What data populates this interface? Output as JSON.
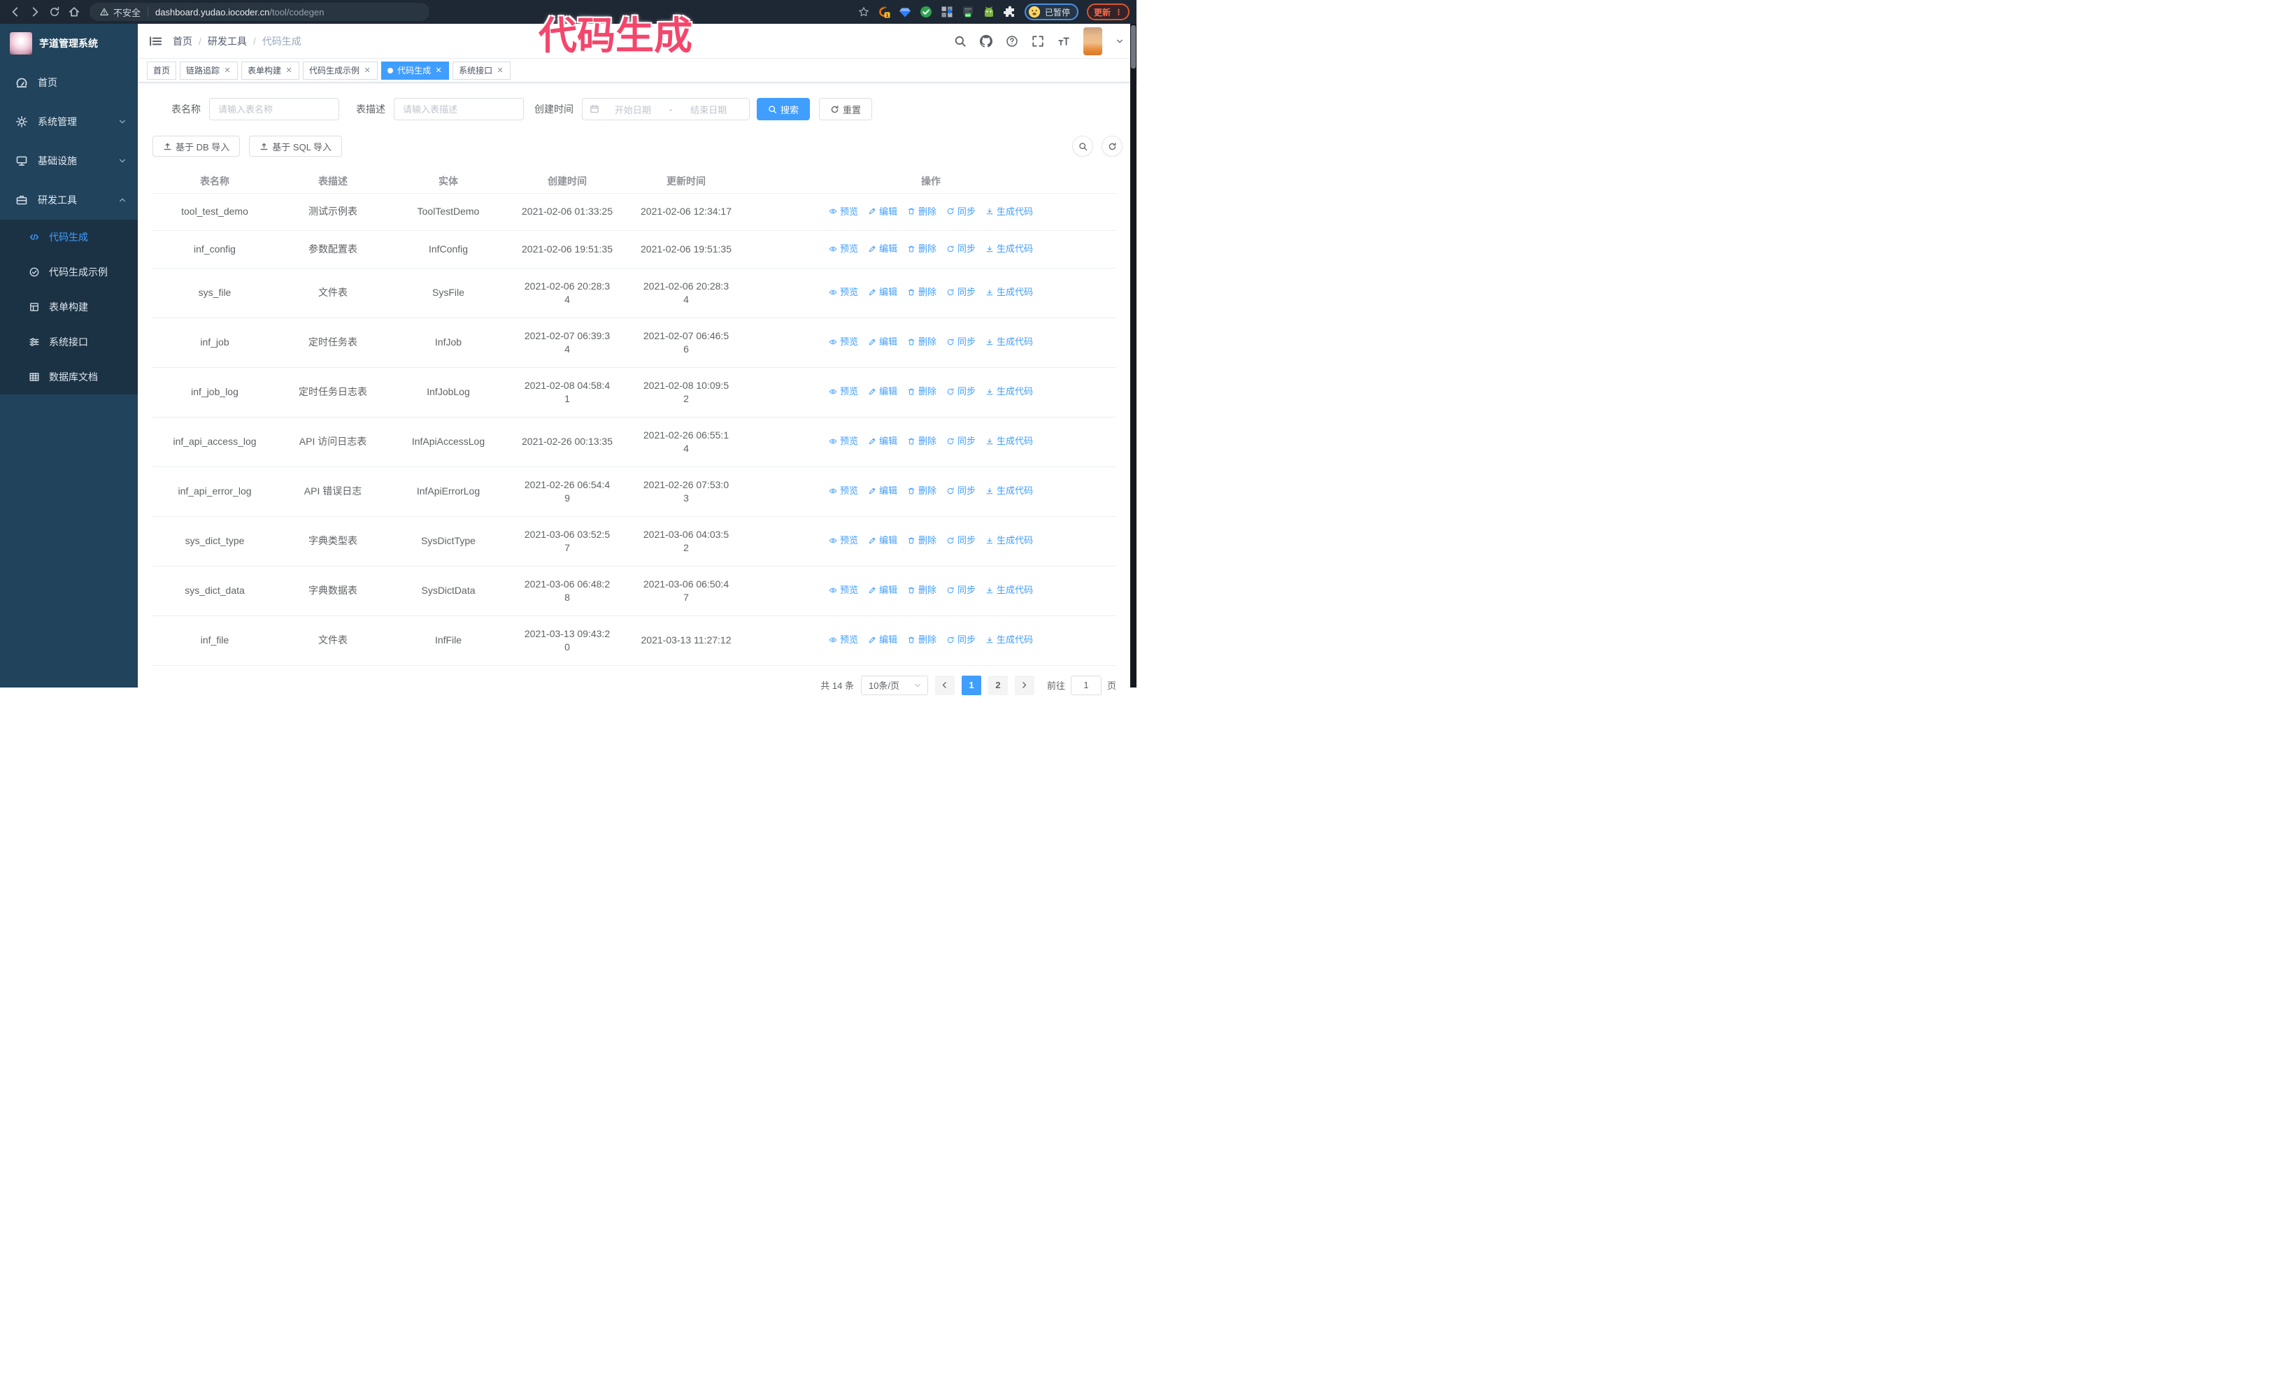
{
  "browser": {
    "nav_icons": [
      "back-icon",
      "forward-icon",
      "reload-icon",
      "home-icon"
    ],
    "security_icon": "warning-icon",
    "security_label": "不安全",
    "url_host": "dashboard.yudao.iocoder.cn",
    "url_path": "/tool/codegen",
    "bookmark_icon": "star-icon",
    "extension_icons": [
      "ext-adblock-icon",
      "ext-gem-icon",
      "ext-check-icon",
      "ext-grid-icon",
      "ext-dark-on-icon",
      "ext-droid-icon",
      "ext-puzzle-icon"
    ],
    "profile_badge": "已暂停",
    "profile_emoji_icon": "emoji-face-icon",
    "update_button": "更新",
    "update_menu_dots": "⋮"
  },
  "annotation": {
    "text": "代码生成",
    "color": "#f4466b"
  },
  "sidebar": {
    "logo_title": "芋道管理系统",
    "menu": [
      {
        "icon": "dashboard-icon",
        "label": "首页"
      },
      {
        "icon": "gear-icon",
        "label": "系统管理",
        "chevron_icon": "chevron-down-icon"
      },
      {
        "icon": "infrastructure-icon",
        "label": "基础设施",
        "chevron_icon": "chevron-down-icon"
      },
      {
        "icon": "tools-icon",
        "label": "研发工具",
        "chevron_icon": "chevron-up-icon",
        "expanded": true
      }
    ],
    "submenu": [
      {
        "icon": "code-icon",
        "label": "代码生成",
        "active": true
      },
      {
        "icon": "example-icon",
        "label": "代码生成示例"
      },
      {
        "icon": "form-icon",
        "label": "表单构建"
      },
      {
        "icon": "api-icon",
        "label": "系统接口"
      },
      {
        "icon": "database-doc-icon",
        "label": "数据库文档"
      }
    ]
  },
  "header": {
    "breadcrumb": [
      {
        "label": "首页"
      },
      {
        "label": "研发工具"
      },
      {
        "label": "代码生成",
        "last": true
      }
    ],
    "action_icons": [
      "search-icon",
      "github-icon",
      "question-icon",
      "fullscreen-icon",
      "fontsize-icon"
    ]
  },
  "tabs": [
    {
      "label": "首页"
    },
    {
      "label": "链路追踪",
      "closable": true
    },
    {
      "label": "表单构建",
      "closable": true
    },
    {
      "label": "代码生成示例",
      "closable": true
    },
    {
      "label": "代码生成",
      "closable": true,
      "active": true
    },
    {
      "label": "系统接口",
      "closable": true
    }
  ],
  "search_form": {
    "table_name_label": "表名称",
    "table_name_placeholder": "请输入表名称",
    "table_desc_label": "表描述",
    "table_desc_placeholder": "请输入表描述",
    "create_time_label": "创建时间",
    "start_date_placeholder": "开始日期",
    "range_separator": "-",
    "end_date_placeholder": "结束日期",
    "search_button": "搜索",
    "reset_button": "重置"
  },
  "toolbar": {
    "import_db_button": "基于 DB 导入",
    "import_sql_button": "基于 SQL 导入",
    "right_buttons": [
      "search-icon",
      "refresh-icon"
    ]
  },
  "table": {
    "columns": [
      {
        "label": "表名称"
      },
      {
        "label": "表描述"
      },
      {
        "label": "实体"
      },
      {
        "label": "创建时间"
      },
      {
        "label": "更新时间"
      },
      {
        "label": "操作"
      }
    ],
    "row_actions": [
      {
        "icon": "eye-icon",
        "label": "预览"
      },
      {
        "icon": "edit-icon",
        "label": "编辑"
      },
      {
        "icon": "delete-icon",
        "label": "删除"
      },
      {
        "icon": "sync-icon",
        "label": "同步"
      },
      {
        "icon": "generate-icon",
        "label": "生成代码"
      }
    ],
    "rows": [
      {
        "name": "tool_test_demo",
        "desc": "测试示例表",
        "entity": "ToolTestDemo",
        "create_time": "2021-02-06 01:33:25",
        "update_time": "2021-02-06 12:34:17"
      },
      {
        "name": "inf_config",
        "desc": "参数配置表",
        "entity": "InfConfig",
        "create_time": "2021-02-06 19:51:35",
        "update_time": "2021-02-06 19:51:35"
      },
      {
        "name": "sys_file",
        "desc": "文件表",
        "entity": "SysFile",
        "create_time": "2021-02-06 20:28:3\n4",
        "update_time": "2021-02-06 20:28:3\n4"
      },
      {
        "name": "inf_job",
        "desc": "定时任务表",
        "entity": "InfJob",
        "create_time": "2021-02-07 06:39:3\n4",
        "update_time": "2021-02-07 06:46:5\n6"
      },
      {
        "name": "inf_job_log",
        "desc": "定时任务日志表",
        "entity": "InfJobLog",
        "create_time": "2021-02-08 04:58:4\n1",
        "update_time": "2021-02-08 10:09:5\n2"
      },
      {
        "name": "inf_api_access_log",
        "desc": "API 访问日志表",
        "entity": "InfApiAccessLog",
        "create_time": "2021-02-26 00:13:35",
        "update_time": "2021-02-26 06:55:1\n4"
      },
      {
        "name": "inf_api_error_log",
        "desc": "API 错误日志",
        "entity": "InfApiErrorLog",
        "create_time": "2021-02-26 06:54:4\n9",
        "update_time": "2021-02-26 07:53:0\n3"
      },
      {
        "name": "sys_dict_type",
        "desc": "字典类型表",
        "entity": "SysDictType",
        "create_time": "2021-03-06 03:52:5\n7",
        "update_time": "2021-03-06 04:03:5\n2"
      },
      {
        "name": "sys_dict_data",
        "desc": "字典数据表",
        "entity": "SysDictData",
        "create_time": "2021-03-06 06:48:2\n8",
        "update_time": "2021-03-06 06:50:4\n7"
      },
      {
        "name": "inf_file",
        "desc": "文件表",
        "entity": "InfFile",
        "create_time": "2021-03-13 09:43:2\n0",
        "update_time": "2021-03-13 11:27:12"
      }
    ]
  },
  "pagination": {
    "total_text": "共 14 条",
    "page_size": "10条/页",
    "prev_icon": "chevron-left-icon",
    "next_icon": "chevron-right-icon",
    "pages": [
      {
        "label": "1",
        "active": true
      },
      {
        "label": "2"
      }
    ],
    "goto_label": "前往",
    "goto_value": "1",
    "goto_suffix": "页"
  },
  "colors": {
    "primary": "#409EFF",
    "annotation": "#F4466B",
    "sidebar_bg": "#21435C",
    "submenu_bg": "#1B3245",
    "chrome_bg": "#1E2834",
    "tab_active": "#409EFF",
    "table_border": "#EBEEF5"
  }
}
